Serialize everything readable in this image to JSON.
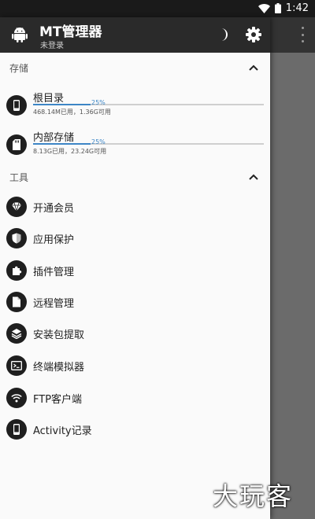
{
  "status_bar": {
    "time": "1:42",
    "wifi_icon": "wifi-icon",
    "battery_icon": "battery-icon"
  },
  "header": {
    "title": "MT管理器",
    "subtitle": "未登录",
    "theme_icon": "moon-icon",
    "settings_icon": "gear-icon",
    "app_icon": "android-icon"
  },
  "sections": {
    "storage": {
      "title": "存储"
    },
    "tools": {
      "title": "工具"
    }
  },
  "storage_items": [
    {
      "name": "根目录",
      "percent": "25%",
      "fill_fraction": 0.25,
      "detail": "468.14M已用，1.36G可用",
      "icon": "phone-icon"
    },
    {
      "name": "内部存储",
      "percent": "25%",
      "fill_fraction": 0.25,
      "detail": "8.13G已用，23.24G可用",
      "icon": "sd-card-icon"
    }
  ],
  "tool_items": [
    {
      "label": "开通会员",
      "icon": "diamond-icon"
    },
    {
      "label": "应用保护",
      "icon": "shield-icon"
    },
    {
      "label": "插件管理",
      "icon": "puzzle-icon"
    },
    {
      "label": "远程管理",
      "icon": "file-icon"
    },
    {
      "label": "安装包提取",
      "icon": "layers-icon"
    },
    {
      "label": "终端模拟器",
      "icon": "terminal-icon"
    },
    {
      "label": "FTP客户端",
      "icon": "wifi-icon"
    },
    {
      "label": "Activity记录",
      "icon": "phone-icon"
    }
  ],
  "watermark": "大玩客",
  "colors": {
    "accent": "#3d86c6",
    "toolbar": "#2a2a2a",
    "drawer_bg": "#fafafa"
  }
}
